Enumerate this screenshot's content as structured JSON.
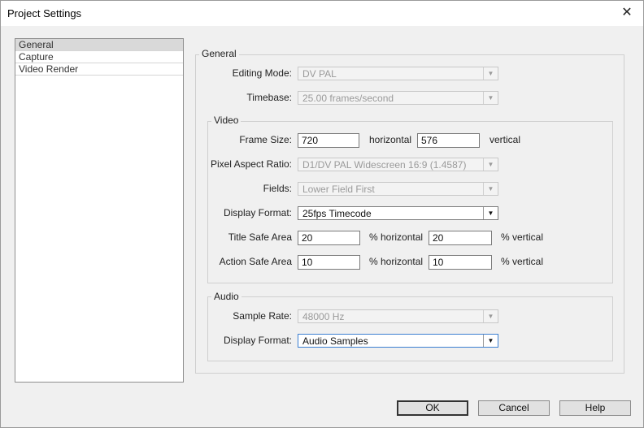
{
  "window": {
    "title": "Project Settings",
    "close_glyph": "✕"
  },
  "sidebar": {
    "items": [
      {
        "label": "General"
      },
      {
        "label": "Capture"
      },
      {
        "label": "Video Render"
      }
    ]
  },
  "general": {
    "legend": "General",
    "editing_mode": {
      "label": "Editing Mode:",
      "value": "DV PAL"
    },
    "timebase": {
      "label": "Timebase:",
      "value": "25.00 frames/second"
    }
  },
  "video": {
    "legend": "Video",
    "frame_size": {
      "label": "Frame Size:",
      "width": "720",
      "horizontal_label": "horizontal",
      "height": "576",
      "vertical_label": "vertical"
    },
    "pixel_aspect_ratio": {
      "label": "Pixel Aspect Ratio:",
      "value": "D1/DV PAL Widescreen 16:9 (1.4587)"
    },
    "fields": {
      "label": "Fields:",
      "value": "Lower Field First"
    },
    "display_format": {
      "label": "Display Format:",
      "value": "25fps Timecode"
    },
    "title_safe": {
      "label": "Title Safe Area",
      "horizontal": "20",
      "horizontal_label": "% horizontal",
      "vertical": "20",
      "vertical_label": "% vertical"
    },
    "action_safe": {
      "label": "Action Safe Area",
      "horizontal": "10",
      "horizontal_label": "% horizontal",
      "vertical": "10",
      "vertical_label": "% vertical"
    }
  },
  "audio": {
    "legend": "Audio",
    "sample_rate": {
      "label": "Sample Rate:",
      "value": "48000 Hz"
    },
    "display_format": {
      "label": "Display Format:",
      "value": "Audio Samples"
    }
  },
  "buttons": {
    "ok": "OK",
    "cancel": "Cancel",
    "help": "Help"
  },
  "icons": {
    "dropdown": "chevron-down-icon",
    "close": "close-icon"
  }
}
